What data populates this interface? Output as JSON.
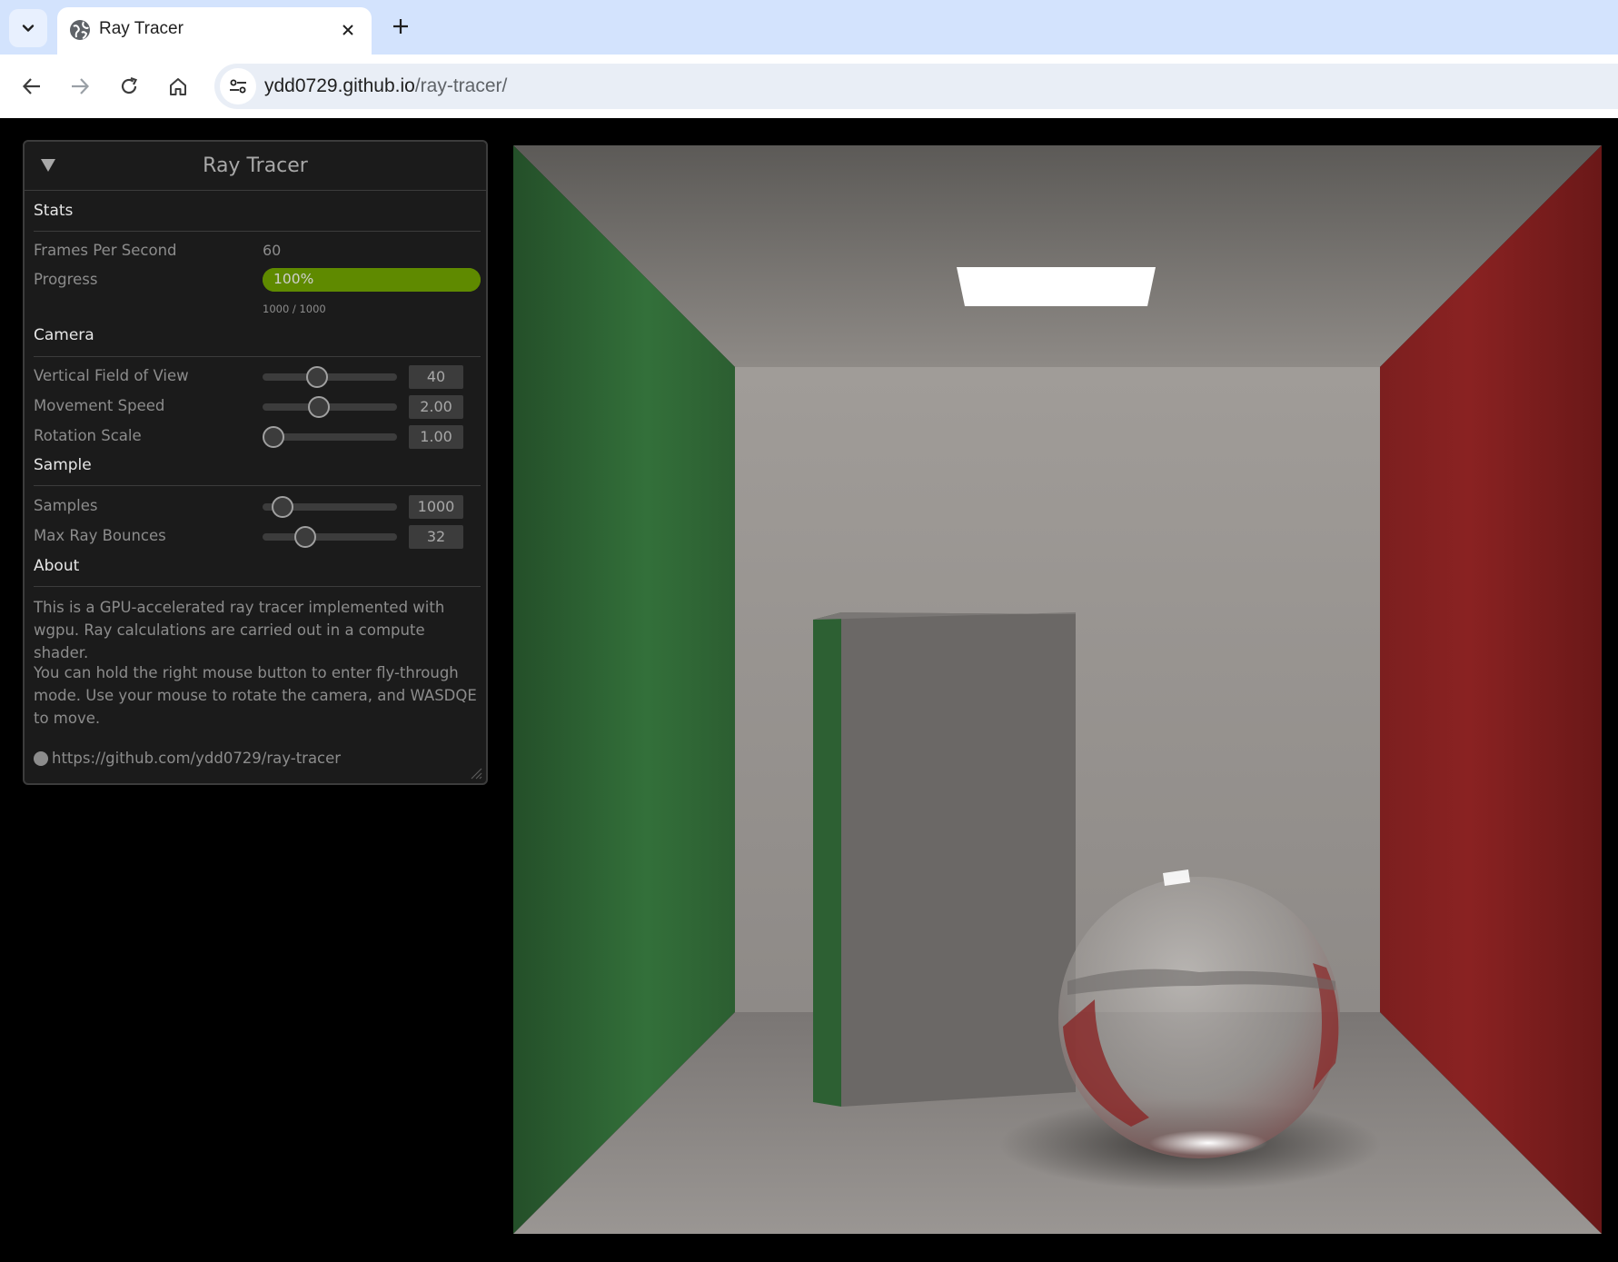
{
  "browser": {
    "tab_title": "Ray Tracer",
    "url_host": "ydd0729.github.io",
    "url_path": "/ray-tracer/"
  },
  "panel": {
    "title": "Ray Tracer",
    "stats": {
      "heading": "Stats",
      "fps_label": "Frames Per Second",
      "fps_value": "60",
      "progress_label": "Progress",
      "progress_text": "100%",
      "progress_fraction": 1.0,
      "progress_count": "1000 / 1000"
    },
    "camera": {
      "heading": "Camera",
      "fov_label": "Vertical Field of View",
      "fov_value": "40",
      "fov_fraction": 0.39,
      "speed_label": "Movement Speed",
      "speed_value": "2.00",
      "speed_fraction": 0.4,
      "rotation_label": "Rotation Scale",
      "rotation_value": "1.00",
      "rotation_fraction": 0.0
    },
    "sample": {
      "heading": "Sample",
      "samples_label": "Samples",
      "samples_value": "1000",
      "samples_fraction": 0.08,
      "bounces_label": "Max Ray Bounces",
      "bounces_value": "32",
      "bounces_fraction": 0.28
    },
    "about": {
      "heading": "About",
      "paragraph1": "This is a GPU-accelerated ray tracer implemented with wgpu. Ray calculations are carried out in a compute shader.",
      "paragraph2": "You can hold the right mouse button to enter fly-through mode. Use your mouse to rotate the camera, and WASDQE to move.",
      "link": "https://github.com/ydd0729/ray-tracer"
    }
  },
  "colors": {
    "tabstrip": "#d3e3fd",
    "progress_green": "#5f8a00",
    "wall_left": "#2e6b35",
    "wall_right": "#8a2121"
  }
}
